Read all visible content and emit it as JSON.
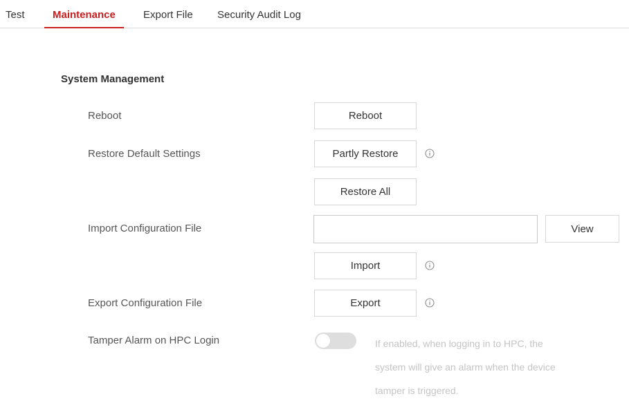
{
  "tabs": [
    {
      "label": "Test",
      "active": false
    },
    {
      "label": "Maintenance",
      "active": true
    },
    {
      "label": "Export File",
      "active": false
    },
    {
      "label": "Security Audit Log",
      "active": false
    }
  ],
  "section": {
    "title": "System Management"
  },
  "rows": {
    "reboot": {
      "label": "Reboot",
      "button": "Reboot"
    },
    "restore": {
      "label": "Restore Default Settings",
      "partly_button": "Partly Restore",
      "all_button": "Restore All"
    },
    "import": {
      "label": "Import Configuration File",
      "file_value": "",
      "view_button": "View",
      "import_button": "Import"
    },
    "export": {
      "label": "Export Configuration File",
      "button": "Export"
    },
    "tamper": {
      "label": "Tamper Alarm on HPC Login",
      "enabled": false,
      "hint_lines": [
        "If enabled, when logging in to HPC, the",
        "system will give an alarm when the device",
        "tamper is triggered."
      ]
    }
  },
  "icons": {
    "info": "info-circle-icon"
  },
  "colors": {
    "accent": "#c81e1e",
    "text": "#333333",
    "label": "#555555",
    "hint": "#c4c4c4",
    "border": "#d6d6d6",
    "toggle_off": "#dedede"
  }
}
